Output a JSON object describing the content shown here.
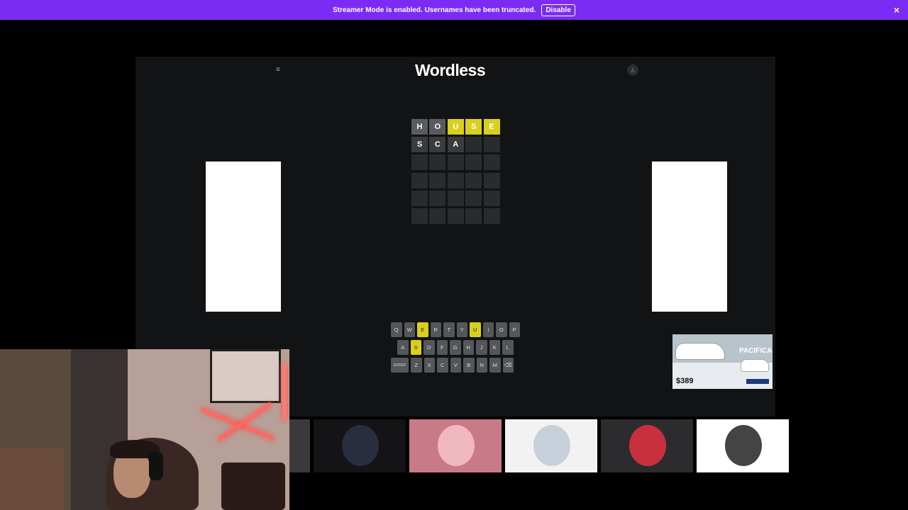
{
  "banner": {
    "message": "Streamer Mode is enabled. Usernames have been truncated.",
    "button_label": "Disable",
    "close_icon": "×"
  },
  "header": {
    "menu_icon": "≡",
    "title": "Wordless",
    "user_icon": "♙"
  },
  "board": {
    "rows": [
      [
        {
          "letter": "H",
          "state": "gray"
        },
        {
          "letter": "O",
          "state": "gray"
        },
        {
          "letter": "U",
          "state": "yellow"
        },
        {
          "letter": "S",
          "state": "yellow"
        },
        {
          "letter": "E",
          "state": "yellow"
        }
      ],
      [
        {
          "letter": "S",
          "state": "typed"
        },
        {
          "letter": "C",
          "state": "typed"
        },
        {
          "letter": "A",
          "state": "typed"
        },
        {
          "letter": "",
          "state": "empty"
        },
        {
          "letter": "",
          "state": "empty"
        }
      ],
      [
        {
          "letter": "",
          "state": "empty"
        },
        {
          "letter": "",
          "state": "empty"
        },
        {
          "letter": "",
          "state": "empty"
        },
        {
          "letter": "",
          "state": "empty"
        },
        {
          "letter": "",
          "state": "empty"
        }
      ],
      [
        {
          "letter": "",
          "state": "empty"
        },
        {
          "letter": "",
          "state": "empty"
        },
        {
          "letter": "",
          "state": "empty"
        },
        {
          "letter": "",
          "state": "empty"
        },
        {
          "letter": "",
          "state": "empty"
        }
      ],
      [
        {
          "letter": "",
          "state": "empty"
        },
        {
          "letter": "",
          "state": "empty"
        },
        {
          "letter": "",
          "state": "empty"
        },
        {
          "letter": "",
          "state": "empty"
        },
        {
          "letter": "",
          "state": "empty"
        }
      ],
      [
        {
          "letter": "",
          "state": "empty"
        },
        {
          "letter": "",
          "state": "empty"
        },
        {
          "letter": "",
          "state": "empty"
        },
        {
          "letter": "",
          "state": "empty"
        },
        {
          "letter": "",
          "state": "empty"
        }
      ]
    ]
  },
  "keyboard": {
    "rows": [
      [
        {
          "k": "Q"
        },
        {
          "k": "W"
        },
        {
          "k": "E",
          "state": "yellow"
        },
        {
          "k": "R"
        },
        {
          "k": "T"
        },
        {
          "k": "Y"
        },
        {
          "k": "U",
          "state": "yellow"
        },
        {
          "k": "I"
        },
        {
          "k": "O"
        },
        {
          "k": "P"
        }
      ],
      [
        {
          "k": "A"
        },
        {
          "k": "S",
          "state": "yellow"
        },
        {
          "k": "D"
        },
        {
          "k": "F"
        },
        {
          "k": "G"
        },
        {
          "k": "H"
        },
        {
          "k": "J"
        },
        {
          "k": "K"
        },
        {
          "k": "L"
        }
      ],
      [
        {
          "k": "ENTER",
          "wide": true
        },
        {
          "k": "Z"
        },
        {
          "k": "X"
        },
        {
          "k": "C"
        },
        {
          "k": "V"
        },
        {
          "k": "B"
        },
        {
          "k": "N"
        },
        {
          "k": "M"
        },
        {
          "k": "⌫"
        }
      ]
    ]
  },
  "car_ad": {
    "brand": "PACIFICA",
    "price": "$389"
  },
  "emote_strip": {
    "thumbs": [
      {
        "name": "thumb-partial",
        "bg": "#3a3a3c",
        "circle": ""
      },
      {
        "name": "thumb-dark-orb",
        "bg": "#141416",
        "circle": "#2a2c40"
      },
      {
        "name": "thumb-pink-avatar",
        "bg": "#c97a88",
        "circle": "#f0b8c0"
      },
      {
        "name": "thumb-yankees-logo",
        "bg": "#f2f2f2",
        "circle": "#c8d0dc"
      },
      {
        "name": "thumb-red-figure",
        "bg": "#2c2c2e",
        "circle": "#c83040"
      },
      {
        "name": "thumb-bw-figure",
        "bg": "#ffffff",
        "circle": "#444"
      }
    ]
  },
  "colors": {
    "banner": "#7b2cf4",
    "panel": "#121314",
    "tile_yellow": "#d8cf1e",
    "tile_gray": "#5a5b5e"
  }
}
